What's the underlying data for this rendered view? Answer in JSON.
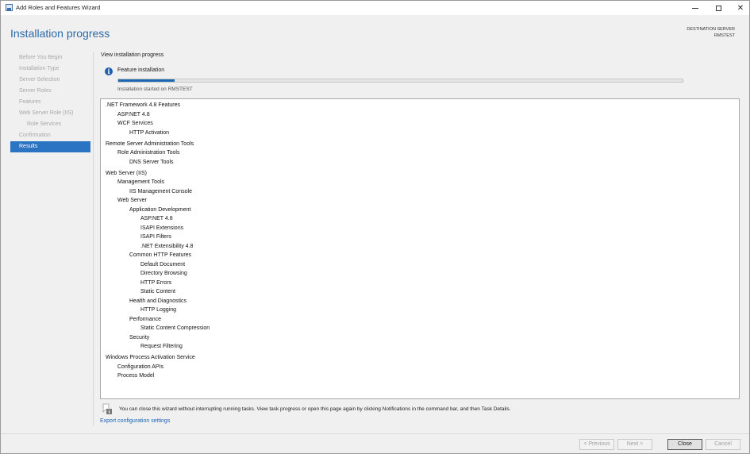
{
  "window": {
    "title": "Add Roles and Features Wizard",
    "controls": {
      "minimize": "minimize-icon",
      "maximize": "maximize-icon",
      "close": "✕"
    }
  },
  "header": {
    "page_title": "Installation progress",
    "destination_label": "DESTINATION SERVER",
    "destination_server": "RMSTEST"
  },
  "nav": {
    "items": [
      {
        "label": "Before You Begin",
        "sub": false,
        "active": false
      },
      {
        "label": "Installation Type",
        "sub": false,
        "active": false
      },
      {
        "label": "Server Selection",
        "sub": false,
        "active": false
      },
      {
        "label": "Server Roles",
        "sub": false,
        "active": false
      },
      {
        "label": "Features",
        "sub": false,
        "active": false
      },
      {
        "label": "Web Server Role (IIS)",
        "sub": false,
        "active": false
      },
      {
        "label": "Role Services",
        "sub": true,
        "active": false
      },
      {
        "label": "Confirmation",
        "sub": false,
        "active": false
      },
      {
        "label": "Results",
        "sub": false,
        "active": true
      }
    ]
  },
  "main": {
    "subheading": "View installation progress",
    "status_title": "Feature installation",
    "progress": 0.1,
    "progress_color": "#1c6aaf",
    "status_text": "Installation started on RMSTEST",
    "tree": [
      {
        "label": ".NET Framework 4.8 Features",
        "level": 0
      },
      {
        "label": "ASP.NET 4.8",
        "level": 1
      },
      {
        "label": "WCF Services",
        "level": 1
      },
      {
        "label": "HTTP Activation",
        "level": 2
      },
      {
        "label": "Remote Server Administration Tools",
        "level": 0
      },
      {
        "label": "Role Administration Tools",
        "level": 1
      },
      {
        "label": "DNS Server Tools",
        "level": 2
      },
      {
        "label": "Web Server (IIS)",
        "level": 0
      },
      {
        "label": "Management Tools",
        "level": 1
      },
      {
        "label": "IIS Management Console",
        "level": 2
      },
      {
        "label": "Web Server",
        "level": 1
      },
      {
        "label": "Application Development",
        "level": 2
      },
      {
        "label": "ASP.NET 4.8",
        "level": 3
      },
      {
        "label": "ISAPI Extensions",
        "level": 3
      },
      {
        "label": "ISAPI Filters",
        "level": 3
      },
      {
        "label": ".NET Extensibility 4.8",
        "level": 3
      },
      {
        "label": "Common HTTP Features",
        "level": 2
      },
      {
        "label": "Default Document",
        "level": 3
      },
      {
        "label": "Directory Browsing",
        "level": 3
      },
      {
        "label": "HTTP Errors",
        "level": 3
      },
      {
        "label": "Static Content",
        "level": 3
      },
      {
        "label": "Health and Diagnostics",
        "level": 2
      },
      {
        "label": "HTTP Logging",
        "level": 3
      },
      {
        "label": "Performance",
        "level": 2
      },
      {
        "label": "Static Content Compression",
        "level": 3
      },
      {
        "label": "Security",
        "level": 2
      },
      {
        "label": "Request Filtering",
        "level": 3
      },
      {
        "label": "Windows Process Activation Service",
        "level": 0
      },
      {
        "label": "Configuration APIs",
        "level": 1
      },
      {
        "label": "Process Model",
        "level": 1
      }
    ],
    "footer_note": "You can close this wizard without interrupting running tasks. View task progress or open this page again by clicking Notifications in the command bar, and then Task Details.",
    "export_link": "Export configuration settings"
  },
  "buttons": {
    "previous": "< Previous",
    "next": "Next >",
    "close": "Close",
    "cancel": "Cancel"
  },
  "colors": {
    "accent": "#2b74c4",
    "title": "#2b6aa8",
    "link": "#1a63b6"
  }
}
